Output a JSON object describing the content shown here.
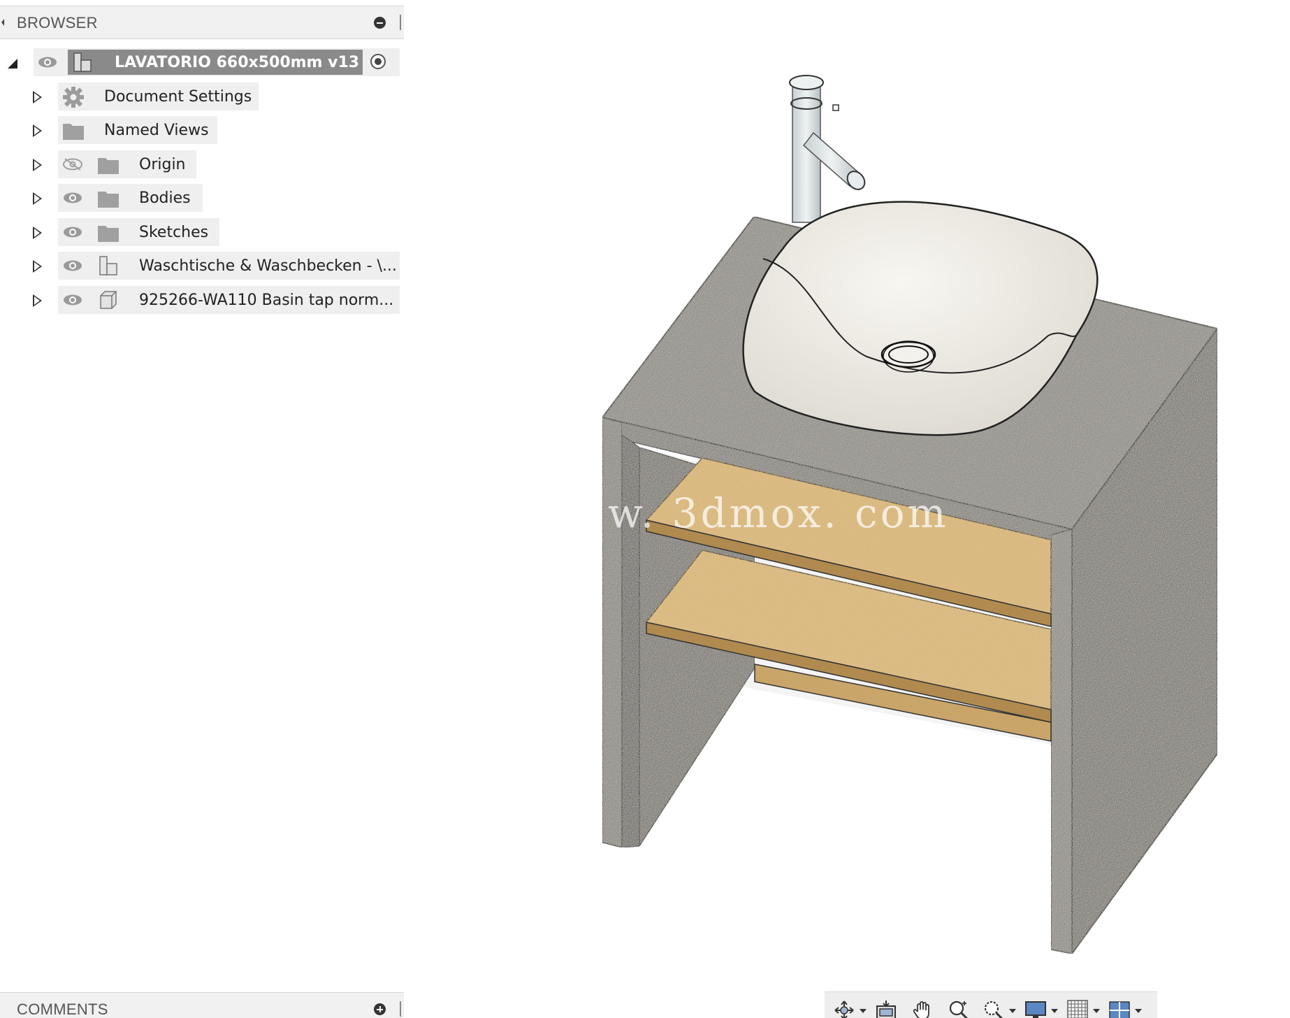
{
  "browser": {
    "title": "BROWSER",
    "root": {
      "label": "LAVATORIO 660x500mm v13"
    },
    "items": [
      {
        "label": "Document Settings",
        "icon": "gear-icon"
      },
      {
        "label": "Named Views",
        "icon": "folder-icon"
      },
      {
        "label": "Origin",
        "icon": "folder-icon",
        "visible": false
      },
      {
        "label": "Bodies",
        "icon": "folder-icon",
        "visible": true
      },
      {
        "label": "Sketches",
        "icon": "folder-icon",
        "visible": true
      },
      {
        "label": "Waschtische & Waschbecken - \\...",
        "icon": "component-icon",
        "visible": true
      },
      {
        "label": "925266-WA110 Basin tap norm...",
        "icon": "body-icon",
        "visible": true
      }
    ]
  },
  "comments": {
    "title": "COMMENTS"
  },
  "viewport": {
    "watermark": "w. 3dmox. com"
  },
  "navbar": {
    "tools": [
      "orbit-icon",
      "look-at-icon",
      "pan-icon",
      "zoom-icon",
      "zoom-window-icon",
      "display-settings-icon",
      "grid-icon",
      "viewports-icon"
    ]
  },
  "colors": {
    "panel_header": "#f1f1f1",
    "root_highlight": "#8a8a8a",
    "granite": "#8f8c85",
    "wood": "#d8b477",
    "basin": "#eeebe4"
  }
}
